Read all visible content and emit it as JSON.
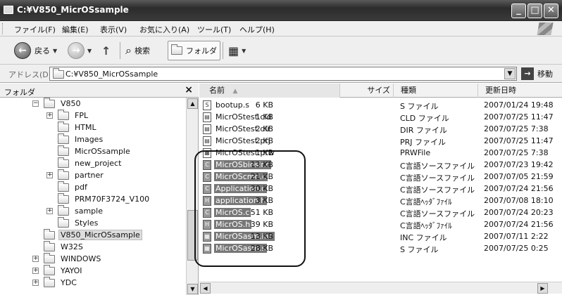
{
  "window": {
    "title": "C:¥V850_MicrOSsample"
  },
  "window_buttons": {
    "minimize": "_",
    "maximize": "□",
    "close": "✕"
  },
  "menu": [
    "ファイル(F)",
    "編集(E)",
    "表示(V)",
    "お気に入り(A)",
    "ツール(T)",
    "ヘルプ(H)"
  ],
  "toolbar": {
    "back_label": "戻る",
    "back_glyph": "←",
    "forward_glyph": "→",
    "up_glyph": "↑",
    "search_label": "検索",
    "folders_label": "フォルダ",
    "views_glyph": "▦"
  },
  "address": {
    "label": "アドレス(D)",
    "value": "C:¥V850_MicrOSsample",
    "go_label": "移動",
    "go_glyph": "→"
  },
  "folder_pane": {
    "title": "フォルダ",
    "close_glyph": "×",
    "tree": [
      {
        "label": "V850",
        "exp": "−",
        "depth": 0,
        "selected": false
      },
      {
        "label": "FPL",
        "exp": "+",
        "depth": 1,
        "selected": false
      },
      {
        "label": "HTML",
        "exp": "",
        "depth": 1,
        "selected": false
      },
      {
        "label": "Images",
        "exp": "",
        "depth": 1,
        "selected": false
      },
      {
        "label": "MicrOSsample",
        "exp": "",
        "depth": 1,
        "selected": false
      },
      {
        "label": "new_project",
        "exp": "",
        "depth": 1,
        "selected": false
      },
      {
        "label": "partner",
        "exp": "+",
        "depth": 1,
        "selected": false
      },
      {
        "label": "pdf",
        "exp": "",
        "depth": 1,
        "selected": false
      },
      {
        "label": "PRM70F3724_V100",
        "exp": "",
        "depth": 1,
        "selected": false
      },
      {
        "label": "sample",
        "exp": "+",
        "depth": 1,
        "selected": false
      },
      {
        "label": "Styles",
        "exp": "",
        "depth": 1,
        "selected": false
      },
      {
        "label": "V850_MicrOSsample",
        "exp": "",
        "depth": 0,
        "selected": true
      },
      {
        "label": "W32S",
        "exp": "",
        "depth": 0,
        "selected": false
      },
      {
        "label": "WINDOWS",
        "exp": "+",
        "depth": 0,
        "selected": false
      },
      {
        "label": "YAYOI",
        "exp": "+",
        "depth": 0,
        "selected": false
      },
      {
        "label": "YDC",
        "exp": "+",
        "depth": 0,
        "selected": false
      }
    ]
  },
  "columns": {
    "name": "名前",
    "sort_glyph": "▲",
    "size": "サイズ",
    "type": "種類",
    "modified": "更新日時"
  },
  "files": [
    {
      "name": "bootup.s",
      "icon": "S",
      "size": "6 KB",
      "type": "S ファイル",
      "modified": "2007/01/24 19:48",
      "selected": false
    },
    {
      "name": "MicrOStest.cld",
      "icon": "▤",
      "size": "1 KB",
      "type": "CLD ファイル",
      "modified": "2007/07/25 11:47",
      "selected": false
    },
    {
      "name": "MicrOStest.dir",
      "icon": "▤",
      "size": "2 KB",
      "type": "DIR ファイル",
      "modified": "2007/07/25 7:38",
      "selected": false
    },
    {
      "name": "MicrOStest.prj",
      "icon": "▤",
      "size": "2 KB",
      "type": "PRJ ファイル",
      "modified": "2007/07/25 11:47",
      "selected": false
    },
    {
      "name": "MicrOStest.prw",
      "icon": "▦",
      "size": "1 KB",
      "type": "PRWFile",
      "modified": "2007/07/25 7:38",
      "selected": false
    },
    {
      "name": "MicrOSbioslr.c",
      "icon": "C",
      "size": "13 KB",
      "type": "C言語ソースファイル",
      "modified": "2007/07/23 19:42",
      "selected": true
    },
    {
      "name": "MicrOScmd.c",
      "icon": "C",
      "size": "21 KB",
      "type": "C言語ソースファイル",
      "modified": "2007/07/05 21:59",
      "selected": true
    },
    {
      "name": "Application.c",
      "icon": "C",
      "size": "30 KB",
      "type": "C言語ソースファイル",
      "modified": "2007/07/24 21:56",
      "selected": true
    },
    {
      "name": "application.h",
      "icon": "H",
      "size": "3 KB",
      "type": "C言語ﾍｯﾀﾞﾌｧｲﾙ",
      "modified": "2007/07/08 18:10",
      "selected": true
    },
    {
      "name": "MicrOS.c",
      "icon": "C",
      "size": "51 KB",
      "type": "C言語ソースファイル",
      "modified": "2007/07/24 20:23",
      "selected": true
    },
    {
      "name": "MicrOS.h",
      "icon": "H",
      "size": "39 KB",
      "type": "C言語ﾍｯﾀﾞﾌｧｲﾙ",
      "modified": "2007/07/24 21:56",
      "selected": true
    },
    {
      "name": "MicrOSasm.inc",
      "icon": "▦",
      "size": "13 KB",
      "type": "INC ファイル",
      "modified": "2007/07/11 2:22",
      "selected": true
    },
    {
      "name": "MicrOSasm.s",
      "icon": "▦",
      "size": "28 KB",
      "type": "S ファイル",
      "modified": "2007/07/25 0:25",
      "selected": true
    }
  ],
  "scroll_glyphs": {
    "up": "▲",
    "down": "▼",
    "left": "◀",
    "right": "▶"
  }
}
